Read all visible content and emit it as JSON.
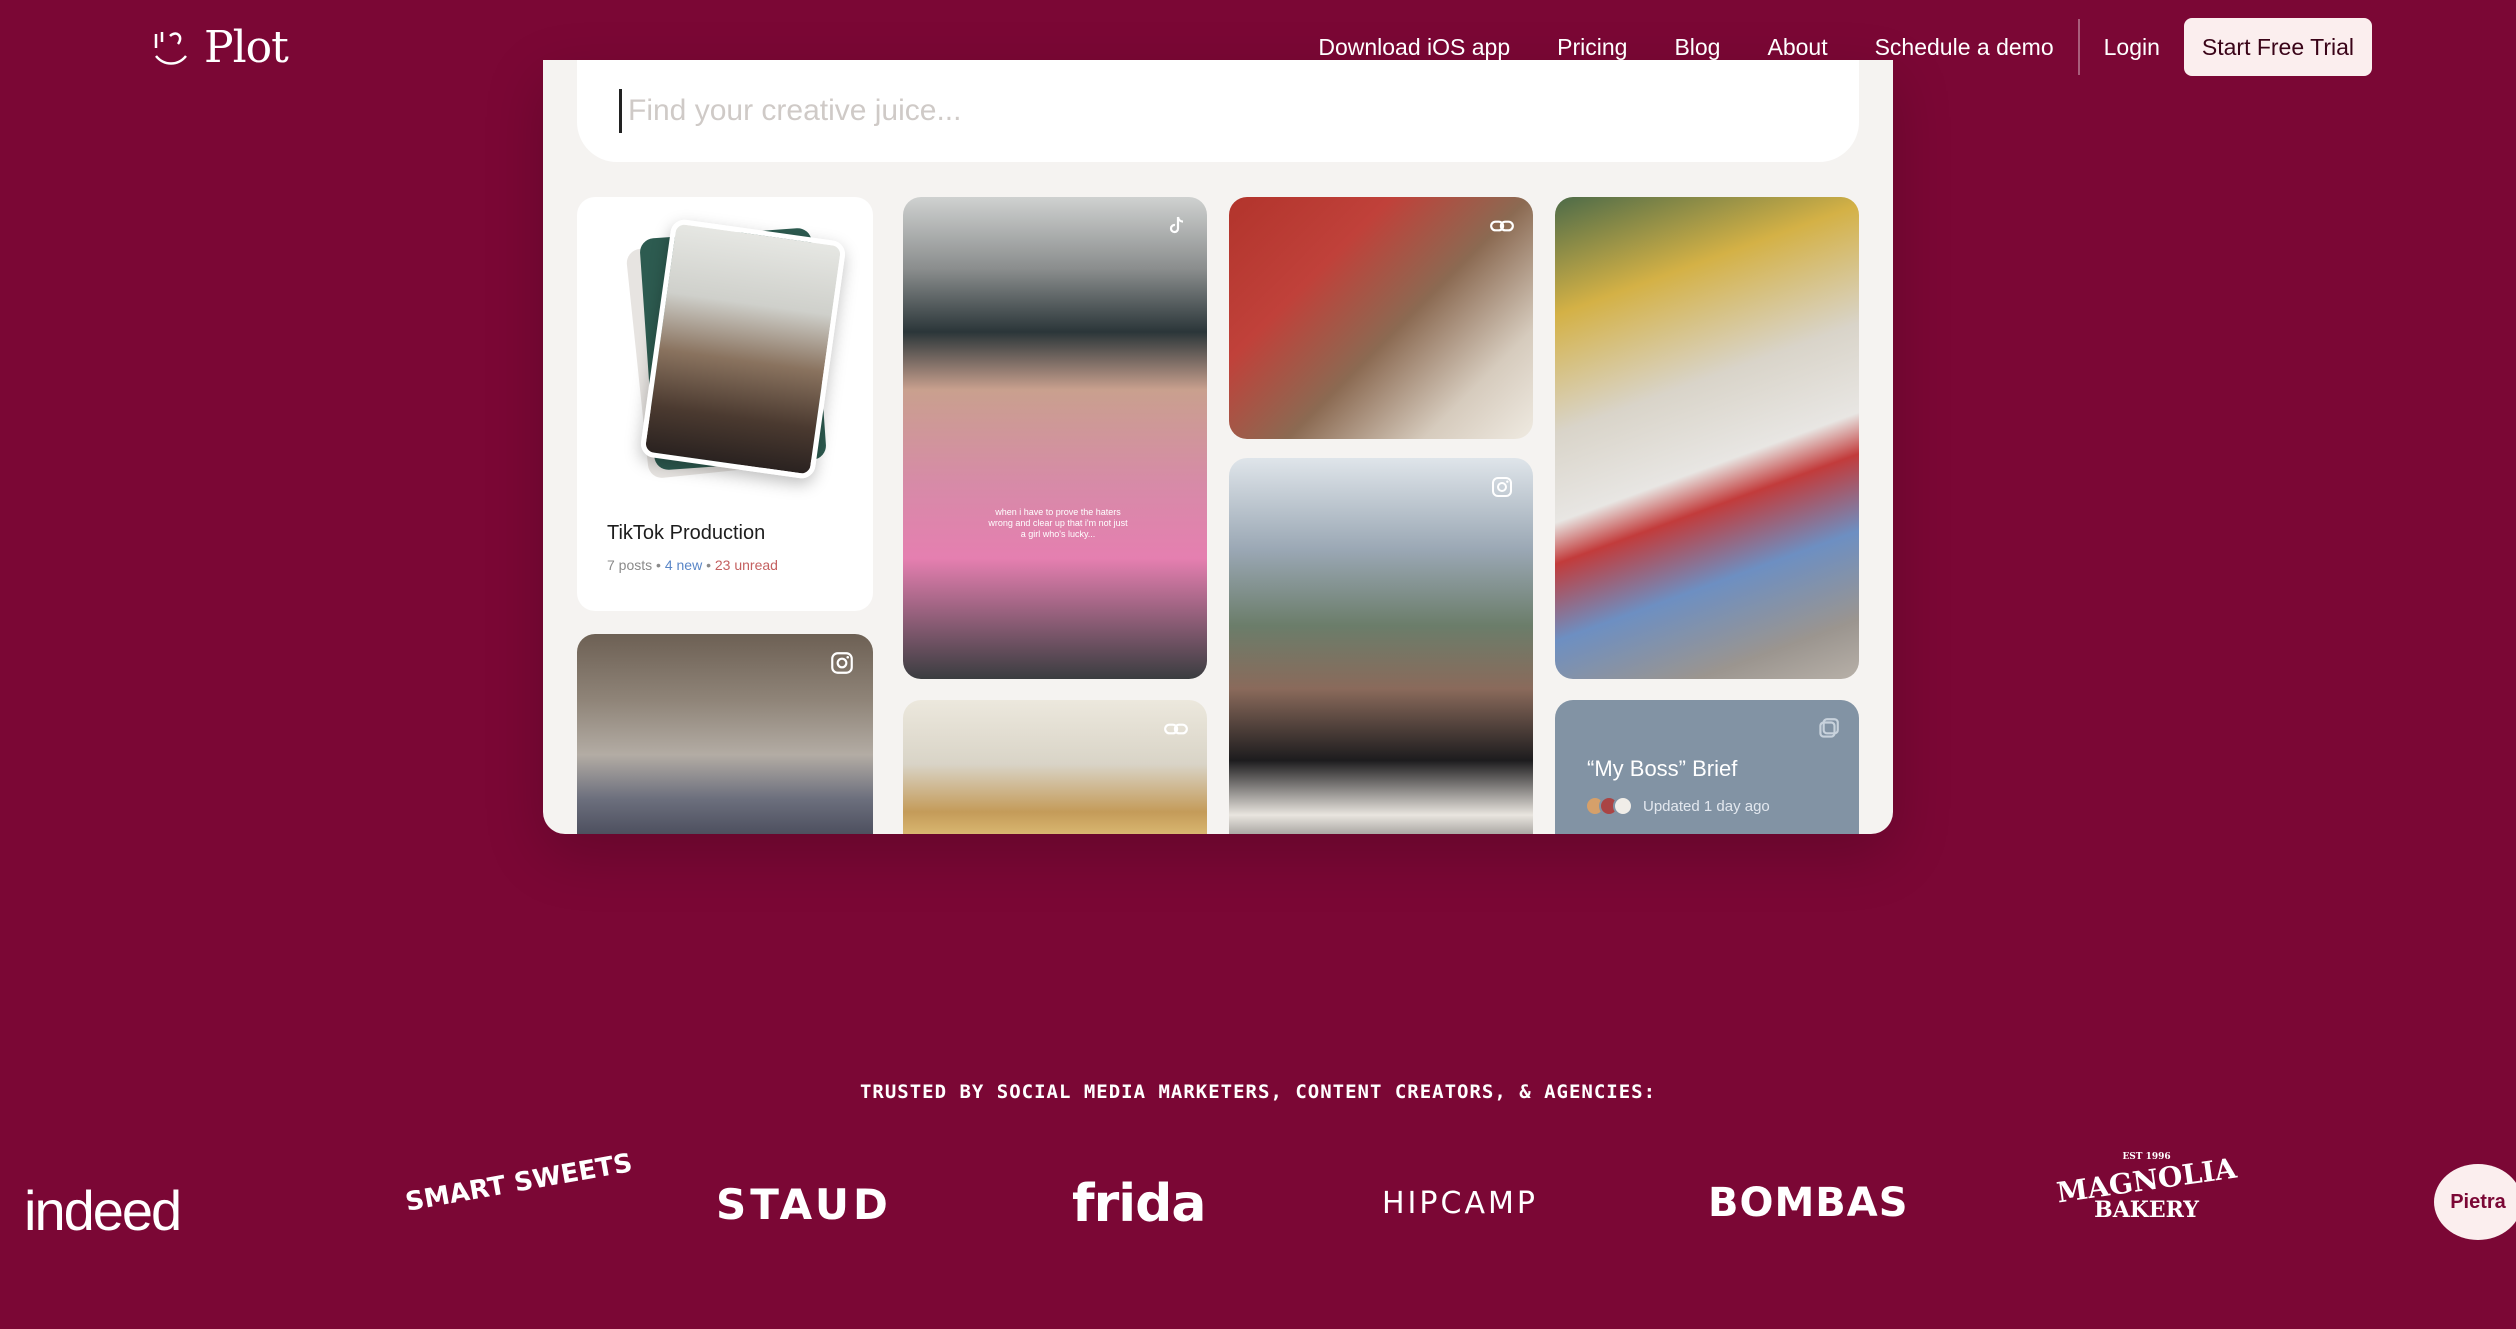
{
  "header": {
    "logo_text": "Plot",
    "nav": {
      "download": "Download iOS app",
      "pricing": "Pricing",
      "blog": "Blog",
      "about": "About",
      "demo": "Schedule a demo",
      "login": "Login",
      "cta": "Start Free Trial"
    }
  },
  "app": {
    "search": {
      "placeholder": "Find your creative juice..."
    },
    "board": {
      "title": "TikTok Production",
      "posts": "7 posts",
      "new": "4 new",
      "unread": "23 unread"
    },
    "brief": {
      "title": "“My Boss” Brief",
      "updated": "Updated 1 day ago"
    },
    "video_caption": "when i have to prove the haters wrong and clear up that i'm not just a girl who's lucky..."
  },
  "trusted": {
    "title": "TRUSTED BY SOCIAL MEDIA MARKETERS, CONTENT CREATORS, & AGENCIES:",
    "logos": {
      "indeed": "indeed",
      "smart_sweets": "SMART SWEETS",
      "staud": "STAUD",
      "frida": "frida",
      "hipcamp": "HIPCAMP",
      "bombas": "BOMBAS",
      "magnolia": "MAGNOLIA",
      "magnolia_sub": "BAKERY",
      "magnolia_est": "EST 1996",
      "pietra": "Pietra"
    }
  },
  "colors": {
    "background": "#7b0735",
    "cta_bg": "#fbeeee",
    "cta_text": "#3a0418",
    "brief_card": "#8293a4"
  }
}
